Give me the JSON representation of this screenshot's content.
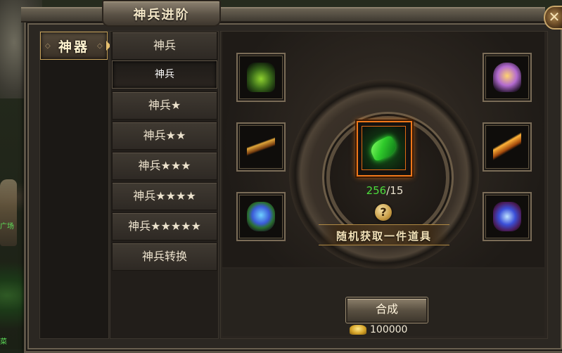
{
  "window": {
    "title": "神兵进阶",
    "close_label": "✕"
  },
  "category": {
    "active_tab": "神器"
  },
  "sub_list": {
    "items": [
      {
        "label": "神兵"
      },
      {
        "label": "神兵"
      },
      {
        "label": "神兵★"
      },
      {
        "label": "神兵★★"
      },
      {
        "label": "神兵★★★"
      },
      {
        "label": "神兵★★★★"
      },
      {
        "label": "神兵★★★★★"
      },
      {
        "label": "神兵转换"
      }
    ],
    "active_index": 1
  },
  "craft": {
    "count_have": "256",
    "count_sep": "/",
    "count_need": "15",
    "help_label": "?",
    "banner_text": "随机获取一件道具",
    "result_item_icon": "green-jade-icon",
    "material_icons": [
      "tank-item-icon",
      "sword-item-icon",
      "orb-staff-icon",
      "crown-item-icon",
      "fire-staff-icon",
      "blue-gem-icon"
    ],
    "button_label": "合成",
    "cost_value": "100000",
    "cost_icon": "gold-ingot-icon"
  },
  "scene": {
    "npc_label_1": "广场",
    "npc_label_2": "菜"
  },
  "colors": {
    "accent_orange": "#f0781a",
    "have_green": "#4cdc3c",
    "gold_border": "#c9a45c"
  }
}
